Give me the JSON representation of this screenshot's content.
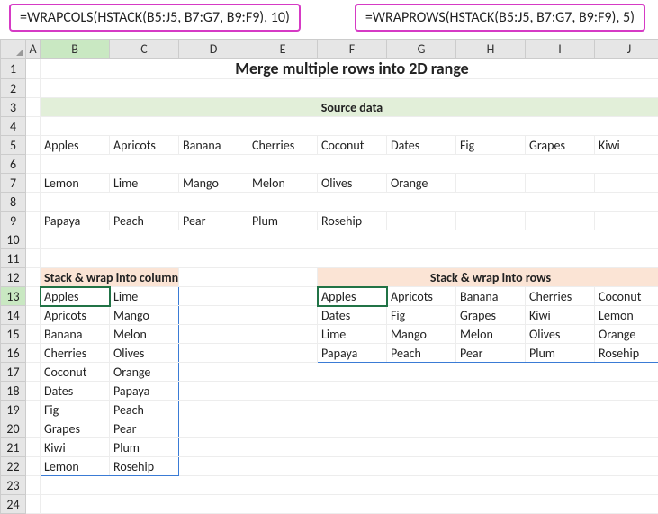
{
  "formulas": {
    "left": "=WRAPCOLS(HSTACK(B5:J5, B7:G7, B9:F9), 10)",
    "right": "=WRAPROWS(HSTACK(B5:J5, B7:G7, B9:F9), 5)"
  },
  "columns": [
    "A",
    "B",
    "C",
    "D",
    "E",
    "F",
    "G",
    "H",
    "I",
    "J"
  ],
  "rows": [
    "1",
    "2",
    "3",
    "4",
    "5",
    "6",
    "7",
    "8",
    "9",
    "10",
    "11",
    "12",
    "13",
    "14",
    "15",
    "16",
    "17",
    "18",
    "19",
    "20",
    "21",
    "22",
    "23",
    "24"
  ],
  "active_col_index": 1,
  "active_row_index": 12,
  "title": "Merge multiple rows into 2D range",
  "subtitle": "Source data",
  "source": {
    "row1": [
      "Apples",
      "Apricots",
      "Banana",
      "Cherries",
      "Coconut",
      "Dates",
      "Fig",
      "Grapes",
      "Kiwi"
    ],
    "row2": [
      "Lemon",
      "Lime",
      "Mango",
      "Melon",
      "Olives",
      "Orange"
    ],
    "row3": [
      "Papaya",
      "Peach",
      "Pear",
      "Plum",
      "Rosehip"
    ]
  },
  "cols_result": {
    "title": "Stack & wrap into columns",
    "data": [
      [
        "Apples",
        "Lime"
      ],
      [
        "Apricots",
        "Mango"
      ],
      [
        "Banana",
        "Melon"
      ],
      [
        "Cherries",
        "Olives"
      ],
      [
        "Coconut",
        "Orange"
      ],
      [
        "Dates",
        "Papaya"
      ],
      [
        "Fig",
        "Peach"
      ],
      [
        "Grapes",
        "Pear"
      ],
      [
        "Kiwi",
        "Plum"
      ],
      [
        "Lemon",
        "Rosehip"
      ]
    ]
  },
  "rows_result": {
    "title": "Stack & wrap into rows",
    "data": [
      [
        "Apples",
        "Apricots",
        "Banana",
        "Cherries",
        "Coconut"
      ],
      [
        "Dates",
        "Fig",
        "Grapes",
        "Kiwi",
        "Lemon"
      ],
      [
        "Lime",
        "Mango",
        "Melon",
        "Olives",
        "Orange"
      ],
      [
        "Papaya",
        "Peach",
        "Pear",
        "Plum",
        "Rosehip"
      ]
    ]
  },
  "chart_data": {
    "type": "table",
    "title": "Merge multiple rows into 2D range",
    "source_rows": [
      [
        "Apples",
        "Apricots",
        "Banana",
        "Cherries",
        "Coconut",
        "Dates",
        "Fig",
        "Grapes",
        "Kiwi"
      ],
      [
        "Lemon",
        "Lime",
        "Mango",
        "Melon",
        "Olives",
        "Orange"
      ],
      [
        "Papaya",
        "Peach",
        "Pear",
        "Plum",
        "Rosehip"
      ]
    ],
    "wrapcols_result": [
      [
        "Apples",
        "Lime"
      ],
      [
        "Apricots",
        "Mango"
      ],
      [
        "Banana",
        "Melon"
      ],
      [
        "Cherries",
        "Olives"
      ],
      [
        "Coconut",
        "Orange"
      ],
      [
        "Dates",
        "Papaya"
      ],
      [
        "Fig",
        "Peach"
      ],
      [
        "Grapes",
        "Pear"
      ],
      [
        "Kiwi",
        "Plum"
      ],
      [
        "Lemon",
        "Rosehip"
      ]
    ],
    "wraprows_result": [
      [
        "Apples",
        "Apricots",
        "Banana",
        "Cherries",
        "Coconut"
      ],
      [
        "Dates",
        "Fig",
        "Grapes",
        "Kiwi",
        "Lemon"
      ],
      [
        "Lime",
        "Mango",
        "Melon",
        "Olives",
        "Orange"
      ],
      [
        "Papaya",
        "Peach",
        "Pear",
        "Plum",
        "Rosehip"
      ]
    ]
  }
}
